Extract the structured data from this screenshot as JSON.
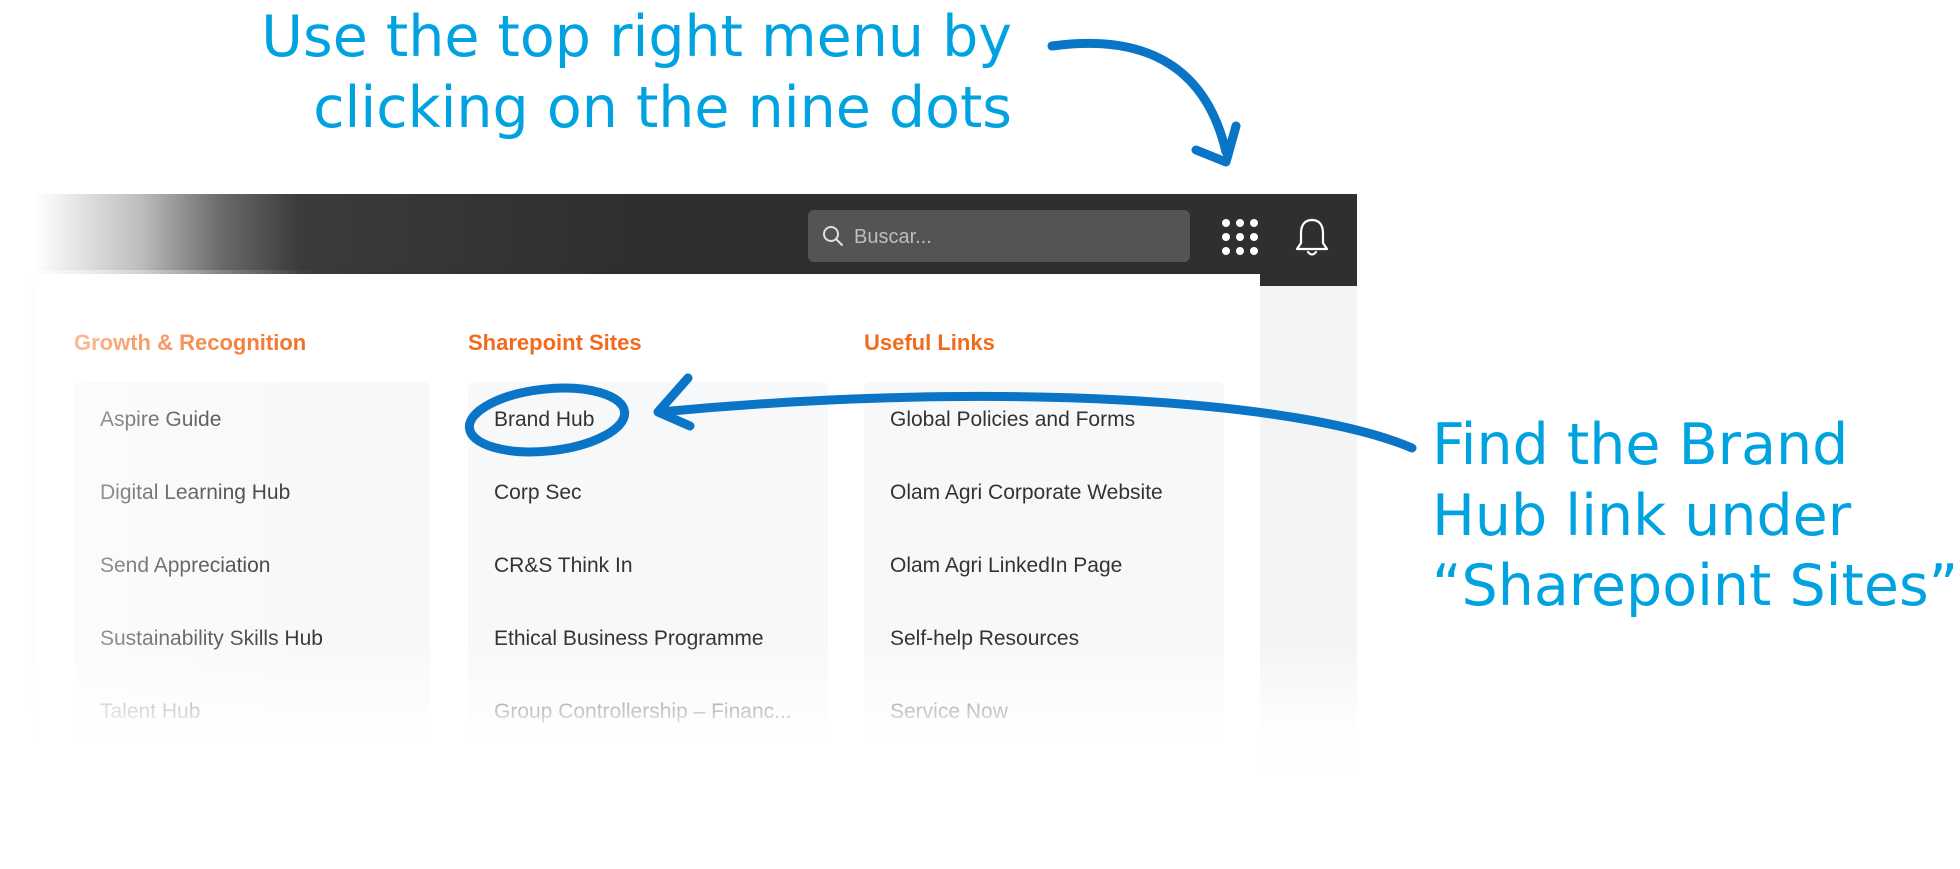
{
  "instructions": {
    "top_line1": "Use the top right menu by",
    "top_line2": "clicking on the nine dots",
    "right_line1": "Find the Brand",
    "right_line2": "Hub link under",
    "right_line3": "“Sharepoint Sites”"
  },
  "header": {
    "search_placeholder": "Buscar...",
    "icons": [
      "search-icon",
      "apps-grid-icon",
      "bell-icon"
    ]
  },
  "menu": {
    "columns": [
      {
        "title": "Growth & Recognition",
        "items": [
          "Aspire Guide",
          "Digital Learning Hub",
          "Send Appreciation",
          "Sustainability Skills Hub",
          "Talent Hub"
        ]
      },
      {
        "title": "Sharepoint Sites",
        "items": [
          "Brand Hub",
          "Corp Sec",
          "CR&S Think In",
          "Ethical Business Programme",
          "Group Controllership – Financ..."
        ]
      },
      {
        "title": "Useful Links",
        "items": [
          "Global Policies and Forms",
          "Olam Agri Corporate Website",
          "Olam Agri LinkedIn Page",
          "Self-help Resources",
          "Service Now"
        ]
      }
    ]
  },
  "colors": {
    "instruction": "#00a3e0",
    "annotation_stroke": "#0a74c7",
    "column_title": "#f26b1d",
    "topbar": "#2f2f2f"
  }
}
